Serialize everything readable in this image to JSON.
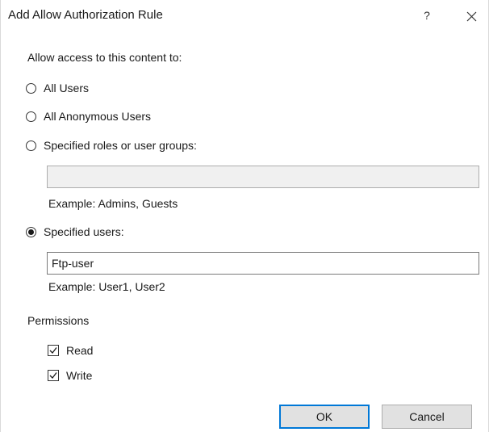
{
  "window": {
    "title": "Add Allow Authorization Rule",
    "help_label": "?",
    "close_icon": "close-icon"
  },
  "access": {
    "heading": "Allow access to this content to:",
    "options": [
      {
        "label": "All Users",
        "selected": false
      },
      {
        "label": "All Anonymous Users",
        "selected": false
      },
      {
        "label": "Specified roles or user groups:",
        "selected": false
      },
      {
        "label": "Specified users:",
        "selected": true
      }
    ],
    "roles_field": {
      "value": "",
      "enabled": false
    },
    "roles_example": "Example: Admins, Guests",
    "users_field": {
      "value": "Ftp-user",
      "enabled": true
    },
    "users_example": "Example: User1, User2"
  },
  "permissions": {
    "heading": "Permissions",
    "items": [
      {
        "label": "Read",
        "checked": true
      },
      {
        "label": "Write",
        "checked": true
      }
    ]
  },
  "buttons": {
    "ok_label": "OK",
    "cancel_label": "Cancel"
  },
  "colors": {
    "accent": "#0078d7",
    "button_face": "#e1e1e1",
    "disabled_field": "#f0f0f0"
  }
}
